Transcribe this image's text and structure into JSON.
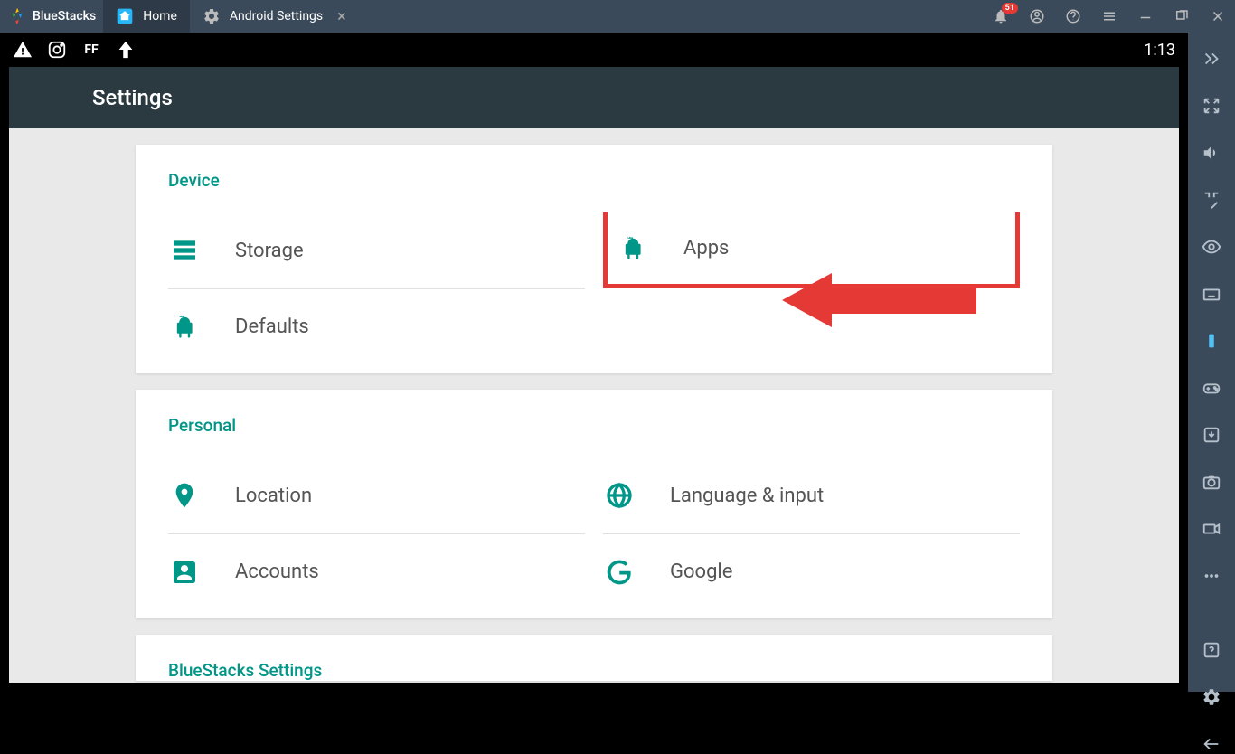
{
  "titlebar": {
    "brand": "BlueStacks",
    "tabs": [
      {
        "label": "Home",
        "icon": "home"
      },
      {
        "label": "Android Settings",
        "icon": "gear"
      }
    ],
    "notification_count": "51"
  },
  "android_status": {
    "time": "1:13"
  },
  "settings": {
    "title": "Settings",
    "sections": [
      {
        "title": "Device",
        "items": [
          {
            "label": "Storage",
            "icon": "storage"
          },
          {
            "label": "Apps",
            "icon": "android",
            "highlighted": true
          },
          {
            "label": "Defaults",
            "icon": "android"
          }
        ]
      },
      {
        "title": "Personal",
        "items": [
          {
            "label": "Location",
            "icon": "location"
          },
          {
            "label": "Language & input",
            "icon": "globe"
          },
          {
            "label": "Accounts",
            "icon": "account"
          },
          {
            "label": "Google",
            "icon": "google"
          }
        ]
      },
      {
        "title": "BlueStacks Settings",
        "items": []
      }
    ]
  },
  "sidebar_icons": [
    "collapse",
    "fullscreen",
    "volume",
    "target",
    "eye",
    "keyboard",
    "phone",
    "gamepad",
    "install",
    "camera",
    "record",
    "more",
    "help",
    "settings",
    "back"
  ]
}
